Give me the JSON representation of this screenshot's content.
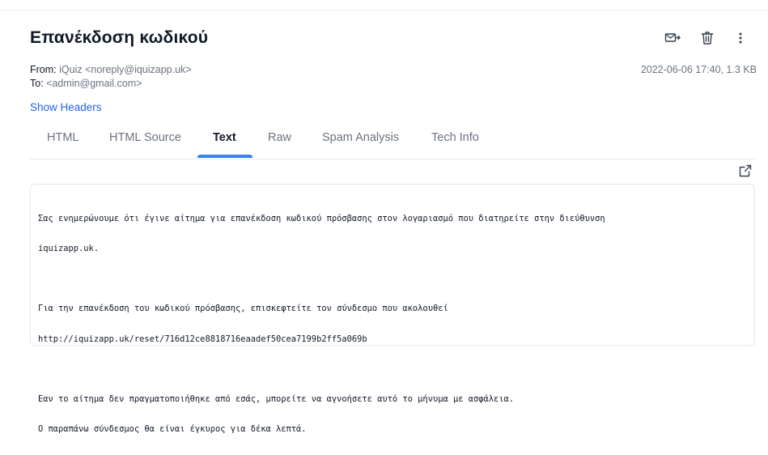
{
  "subject": "Επανέκδοση κωδικού",
  "from": {
    "label": "From:",
    "value": "iQuiz <noreply@iquizapp.uk>"
  },
  "to": {
    "label": "To:",
    "value": "<admin@gmail.com>"
  },
  "date_size": "2022-06-06 17:40, 1.3 KB",
  "show_headers": "Show Headers",
  "actions": [
    "forward-mail-icon",
    "trash-icon",
    "more-vertical-icon"
  ],
  "tabs": [
    {
      "label": "HTML",
      "active": false
    },
    {
      "label": "HTML Source",
      "active": false
    },
    {
      "label": "Text",
      "active": true
    },
    {
      "label": "Raw",
      "active": false
    },
    {
      "label": "Spam Analysis",
      "active": false
    },
    {
      "label": "Tech Info",
      "active": false
    }
  ],
  "colors": {
    "accent": "#3b82f6",
    "link": "#2563eb",
    "muted": "#6b7280"
  },
  "body_lines": [
    "Σας ενημερώνουμε ότι έγινε αίτημα για επανέκδοση κωδικού πρόσβασης στον λογαριασμό που διατηρείτε στην διεύθυνση",
    "iquizapp.uk.",
    "",
    "Για την επανέκδοση του κωδικού πρόσβασης, επισκεφτείτε τον σύνδεσμο που ακολουθεί",
    "http://iquizapp.uk/reset/716d12ce8818716eaadef50cea7199b2ff5a069b",
    "",
    "Εαν το αίτημα δεν πραγματοποιήθηκε από εσάς, μπορείτε να αγνοήσετε αυτό το μήνυμα με ασφάλεια.",
    "Ο παραπάνω σύνδεσμος θα είναι έγκυρος για δέκα λεπτά."
  ]
}
